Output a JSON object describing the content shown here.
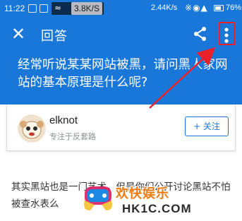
{
  "status_bar": {
    "time": "11:22",
    "speed_badge": "3.8K/S",
    "net_speed": "2.44K/s",
    "battery": "76%",
    "battery_level": 0.76,
    "icons": [
      "notification-icon",
      "app-icon",
      "wifi-icon",
      "bluetooth-icon",
      "alarm-icon",
      "wifi-icon",
      "signal-icon",
      "battery-icon"
    ]
  },
  "toolbar": {
    "title": "回答",
    "close_icon": "close-icon",
    "share_icon": "share-icon",
    "more_icon": "more-vertical-icon"
  },
  "question": {
    "text": "经常听说某某网站被黑，请问黑人家网站的基本原理是什么呢?"
  },
  "author": {
    "name": "elknot",
    "tagline": "专注于反套路",
    "follow_label": "+ 关注"
  },
  "answer": {
    "text": "其实黑站也是一门艺术，但是你们公开讨论黑站不怕被查水表么"
  },
  "watermark": {
    "cn": "欢快娱乐",
    "url": "HK1C.COM"
  },
  "colors": {
    "primary": "#1877d9",
    "highlight": "#e8212a",
    "watermark_orange": "#f07a12"
  }
}
